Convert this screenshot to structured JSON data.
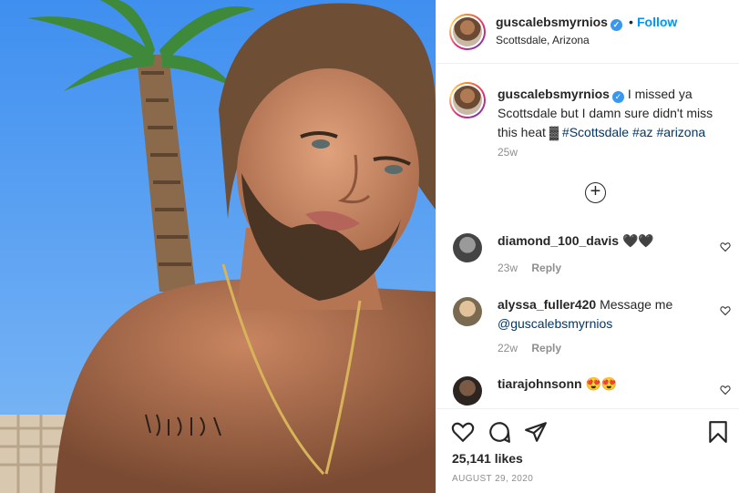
{
  "post": {
    "username": "guscalebsmyrnios",
    "follow_label": "Follow",
    "dot": "•",
    "location": "Scottsdale, Arizona"
  },
  "caption": {
    "username": "guscalebsmyrnios",
    "text": "I missed ya Scottsdale but I damn sure didn't miss this heat ▓",
    "tags": [
      "#Scottsdale",
      "#az",
      "#arizona"
    ],
    "time": "25w"
  },
  "load_more_icon": "plus-circle-icon",
  "comments": [
    {
      "username": "diamond_100_davis",
      "text": "🖤🖤",
      "time": "23w",
      "reply_label": "Reply"
    },
    {
      "username": "alyssa_fuller420",
      "text": "Message me",
      "mention": "@guscalebsmyrnios",
      "time": "22w",
      "reply_label": "Reply"
    },
    {
      "username": "tiarajohnsonn",
      "text": "😍😍"
    }
  ],
  "actions": {
    "like_icon": "heart-icon",
    "comment_icon": "comment-icon",
    "share_icon": "send-icon",
    "save_icon": "bookmark-icon",
    "likes": "25,141 likes",
    "date": "AUGUST 29, 2020"
  },
  "colors": {
    "accent": "#0095f6",
    "verified": "#3897f0",
    "tag": "#00376b",
    "muted": "#8e8e8e"
  }
}
